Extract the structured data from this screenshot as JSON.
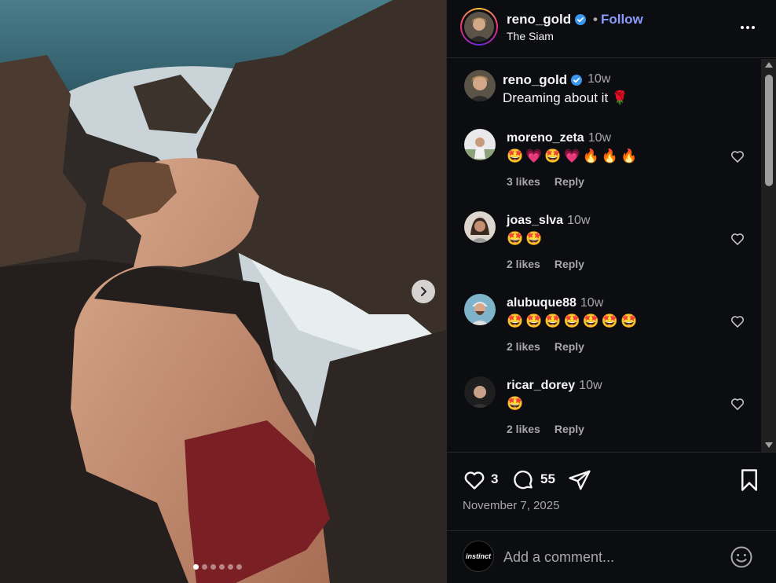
{
  "post": {
    "username": "reno_gold",
    "follow_label": "Follow",
    "separator": "•",
    "location": "The Siam",
    "date": "November 7, 2025",
    "like_count": "3",
    "comment_count": "55",
    "carousel": {
      "dots": 6,
      "active_index": 0
    }
  },
  "caption": {
    "username": "reno_gold",
    "time": "10w",
    "text": "Dreaming about it 🌹"
  },
  "comments": [
    {
      "username": "moreno_zeta",
      "time": "10w",
      "text": "🤩💗🤩💗🔥🔥🔥",
      "likes": "3 likes",
      "reply": "Reply"
    },
    {
      "username": "joas_slva",
      "time": "10w",
      "text": "🤩🤩",
      "likes": "2 likes",
      "reply": "Reply"
    },
    {
      "username": "alubuque88",
      "time": "10w",
      "text": "🤩🤩🤩🤩🤩🤩🤩",
      "likes": "2 likes",
      "reply": "Reply"
    },
    {
      "username": "ricar_dorey",
      "time": "10w",
      "text": "🤩",
      "likes": "2 likes",
      "reply": "Reply"
    }
  ],
  "composer": {
    "avatar_text": "instinct",
    "placeholder": "Add a comment..."
  },
  "colors": {
    "accent_follow": "#8a9cff",
    "verified_blue": "#3897f0",
    "panel_bg": "#0c0d10"
  },
  "icons": [
    "verified-badge-icon",
    "more-options-icon",
    "heart-icon",
    "comment-icon",
    "share-icon",
    "save-icon",
    "emoji-icon",
    "chevron-right-icon"
  ]
}
